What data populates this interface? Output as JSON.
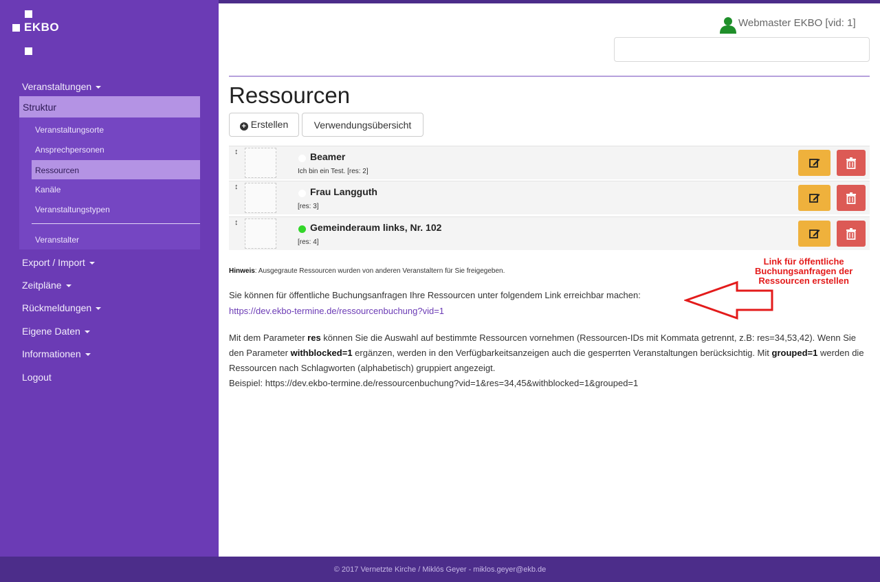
{
  "sidebar": {
    "logo_text": "EKBO",
    "nav": {
      "veranstaltungen": "Veranstaltungen",
      "struktur": "Struktur",
      "sub": {
        "veranstaltungsorte": "Veranstaltungsorte",
        "ansprechpersonen": "Ansprechpersonen",
        "ressourcen": "Ressourcen",
        "kanaele": "Kanäle",
        "veranstaltungstypen": "Veranstaltungstypen",
        "veranstalter": "Veranstalter"
      },
      "export_import": "Export / Import",
      "zeitplaene": "Zeitpläne",
      "rueckmeldungen": "Rückmeldungen",
      "eigene_daten": "Eigene Daten",
      "informationen": "Informationen",
      "logout": "Logout"
    }
  },
  "header": {
    "user_name": "Webmaster EKBO [vid: 1]",
    "search_value": ""
  },
  "main": {
    "title": "Ressourcen",
    "btn_create": "Erstellen",
    "btn_usage": "Verwendungsübersicht",
    "drag_glyph": "↕",
    "rows": [
      {
        "name": "Beamer",
        "sub": "Ich bin ein Test. [res: 2]",
        "status_color": "#ffffff"
      },
      {
        "name": "Frau Langguth",
        "sub": "[res: 3]",
        "status_color": "#ffffff"
      },
      {
        "name": "Gemeinderaum links, Nr. 102",
        "sub": "[res: 4]",
        "status_color": "#33d62a"
      }
    ],
    "hint_label": "Hinweis",
    "hint_text": ": Ausgegraute Ressourcen wurden von anderen Veranstaltern für Sie freigegeben.",
    "public_text": "Sie können für öffentliche Buchungsanfragen Ihre Ressourcen unter folgendem Link erreichbar machen:",
    "public_link": "https://dev.ekbo-termine.de/ressourcenbuchung?vid=1",
    "param_text_1": "Mit dem Parameter ",
    "param_res": "res",
    "param_text_2": " können Sie die Auswahl auf bestimmte Ressourcen vornehmen (Ressourcen-IDs mit Kommata getrennt, z.B: res=34,53,42). Wenn Sie den Parameter ",
    "param_withblocked": "withblocked=1",
    "param_text_3": " ergänzen, werden in den Verfügbarkeitsanzeigen auch die gesperrten Veranstaltungen berücksichtig. Mit ",
    "param_grouped": "grouped=1",
    "param_text_4": " werden die Ressourcen nach Schlagworten (alphabetisch) gruppiert angezeigt.",
    "example": "Beispiel: https://dev.ekbo-termine.de/ressourcenbuchung?vid=1&res=34,45&withblocked=1&grouped=1"
  },
  "annotation": {
    "line1": "Link für öffentliche",
    "line2": "Buchungsanfragen der",
    "line3": "Ressourcen erstellen",
    "color": "#e31b1b"
  },
  "footer": {
    "text": "© 2017 Vernetzte Kirche / Miklós Geyer - miklos.geyer@ekb.de"
  },
  "colors": {
    "sidebar": "#6b3bb5",
    "sidebar_active": "#b493e4",
    "edit": "#efb13c",
    "delete": "#dc5a55",
    "footer": "#4c2d8a"
  },
  "icons": [
    "user-icon",
    "plus-circle-icon",
    "drag-handle-icon",
    "edit-icon",
    "trash-icon",
    "arrow-left-icon"
  ]
}
